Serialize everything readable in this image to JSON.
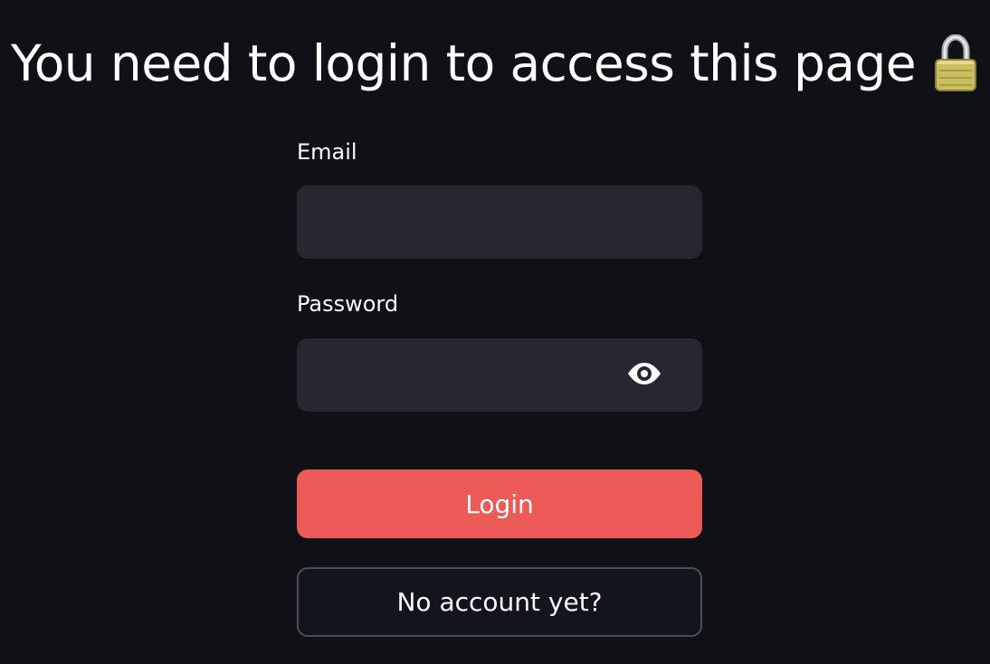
{
  "page": {
    "title": "You need to login to access this page",
    "title_icon": "lock-icon"
  },
  "form": {
    "email": {
      "label": "Email",
      "value": "",
      "placeholder": ""
    },
    "password": {
      "label": "Password",
      "value": "",
      "placeholder": "",
      "visibility_icon": "eye-icon"
    },
    "login_button_label": "Login",
    "signup_button_label": "No account yet?"
  },
  "colors": {
    "background": "#0f1116",
    "input_background": "#262730",
    "primary": "#eb5a56",
    "secondary_button_border": "#4d4f57",
    "text": "#fafafa"
  }
}
